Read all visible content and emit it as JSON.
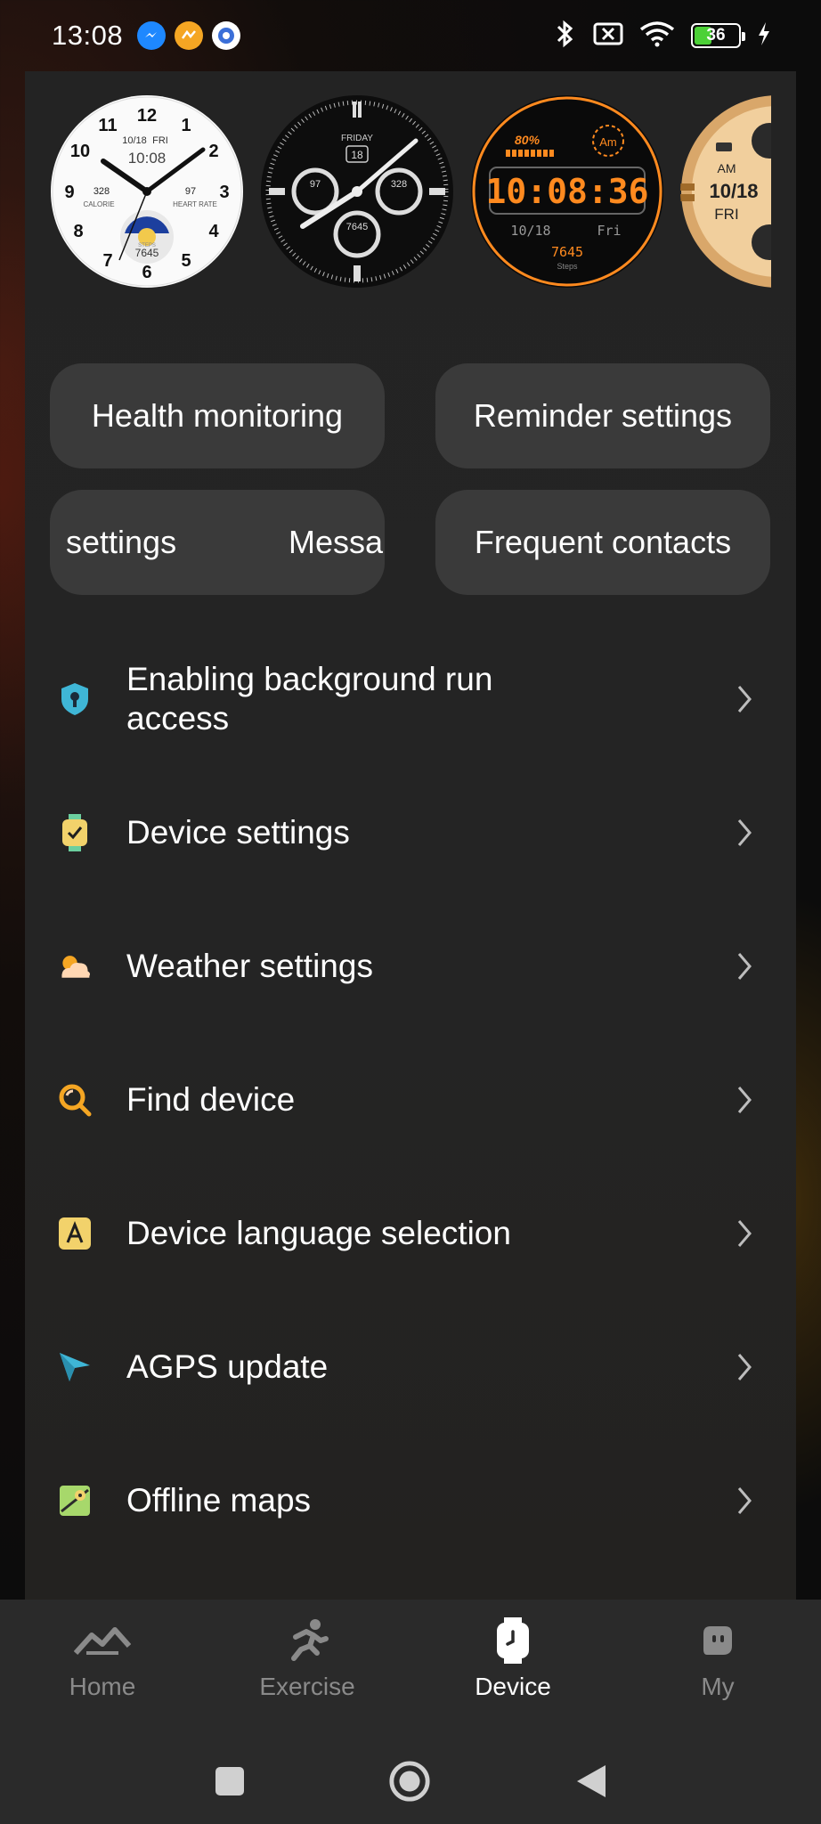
{
  "status_bar": {
    "time": "13:08",
    "battery_level": "36",
    "icons": [
      "messenger-icon",
      "app-notification-icon",
      "settings-gear-icon",
      "bluetooth-icon",
      "sim-x-icon",
      "wifi-icon",
      "battery-icon",
      "charging-icon"
    ]
  },
  "watch_faces": [
    {
      "name": "analog-white",
      "numbers": [
        "12",
        "1",
        "2",
        "3",
        "4",
        "5",
        "6",
        "7",
        "8",
        "9",
        "10",
        "11"
      ],
      "date": "10/18",
      "day": "FRI",
      "time": "10:08",
      "calorie_value": "328",
      "calorie_label": "CALORIE",
      "heart_value": "97",
      "heart_label": "HEART RATE",
      "steps_label": "STEPS",
      "steps_value": "7645"
    },
    {
      "name": "analog-black",
      "day": "FRIDAY",
      "date": "18",
      "left_value": "97",
      "right_value": "328",
      "bottom_value": "7645"
    },
    {
      "name": "digital-orange",
      "battery": "80%",
      "ampm": "Am",
      "time": "10:08:36",
      "date": "10/18",
      "day": "Fri",
      "steps": "7645",
      "steps_label": "Steps"
    },
    {
      "name": "gold-partial",
      "ampm": "AM",
      "date": "10/18",
      "day": "FRI"
    }
  ],
  "quick_buttons": {
    "health": "Health monitoring",
    "reminder": "Reminder settings",
    "message_part_a": "settings",
    "message_part_b": "Messa",
    "contacts": "Frequent contacts"
  },
  "menu": [
    {
      "label": "Enabling background run\naccess",
      "icon": "shield-lock-icon"
    },
    {
      "label": "Device settings",
      "icon": "watch-check-icon"
    },
    {
      "label": "Weather settings",
      "icon": "weather-sun-cloud-icon"
    },
    {
      "label": "Find device",
      "icon": "search-icon"
    },
    {
      "label": "Device language selection",
      "icon": "language-a-icon"
    },
    {
      "label": "AGPS update",
      "icon": "location-arrow-icon"
    },
    {
      "label": "Offline maps",
      "icon": "map-icon"
    }
  ],
  "bottom_nav": {
    "home": "Home",
    "exercise": "Exercise",
    "device": "Device",
    "my": "My",
    "active": "Device"
  },
  "colors": {
    "panel": "#232323",
    "button": "#3a3a3a",
    "accent_orange": "#ff8a1f",
    "inactive_nav": "#8a8a8a"
  }
}
